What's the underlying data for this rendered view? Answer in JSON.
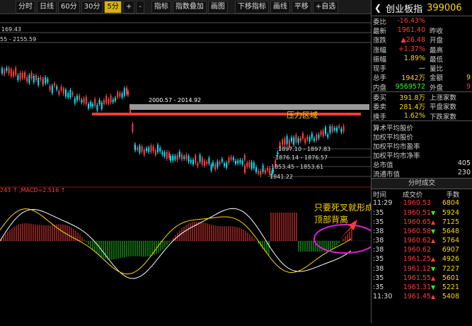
{
  "toolbar": {
    "buttons": [
      "分时",
      "日线",
      "60分",
      "30分",
      "5分",
      "+",
      "-",
      "指标",
      "指数叠加",
      "画图",
      "下移指标",
      "画线",
      "平移",
      "+自选"
    ],
    "active": "5分"
  },
  "chart": {
    "levels": [
      "169.43",
      "55 - 2155.59"
    ],
    "zone_label": "2000.57 - 2014.92",
    "pressure_label": "压力区域",
    "price_labels": [
      "1897.10 - 1897.83",
      "1876.14 - 1876.57",
      "1853.45 - 1853.61",
      "1841.22"
    ],
    "macd_label": "243 ↑ ,MACD=2.516 ↑",
    "annotation_line1": "只要死叉就形成",
    "annotation_line2": "顶部背离",
    "colors": {
      "pressure": "#ff3a3a",
      "zone": "#9a9a9a",
      "annotation": "#ffd800",
      "ellipse": "#e020e0",
      "up": "#ff4040",
      "down": "#00e8ff"
    }
  },
  "panel": {
    "back": "❮",
    "title": "创业板指",
    "code": "399006",
    "quote": [
      {
        "l1": "委比",
        "v1": "-16.43%",
        "c1": "red",
        "l2": "",
        "v2": "",
        "c2": "white"
      },
      {
        "l1": "最新",
        "v1": "1961.40",
        "c1": "red",
        "l2": "昨收",
        "v2": "",
        "c2": "white"
      },
      {
        "l1": "涨跌",
        "v1": "▲26.48",
        "c1": "red",
        "l2": "开盘",
        "v2": "",
        "c2": "white"
      },
      {
        "l1": "涨幅",
        "v1": "+1.37%",
        "c1": "red",
        "l2": "最高",
        "v2": "",
        "c2": "white"
      },
      {
        "l1": "振幅",
        "v1": "1.89%",
        "c1": "yellow",
        "l2": "最低",
        "v2": "",
        "c2": "white"
      },
      {
        "l1": "现手",
        "v1": "—",
        "c1": "white",
        "l2": "量比",
        "v2": "",
        "c2": "white"
      },
      {
        "l1": "总手",
        "v1": "1942万",
        "c1": "yellow",
        "l2": "金额",
        "v2": "9",
        "c2": "yellow"
      },
      {
        "l1": "内盘",
        "v1": "9569572",
        "c1": "green",
        "l2": "外盘",
        "v2": "9",
        "c2": "red"
      }
    ],
    "quote2": [
      {
        "l1": "委买",
        "v1": "391.8万",
        "c1": "yellow",
        "l2": "上涨家数",
        "v2": "",
        "c2": "white"
      },
      {
        "l1": "委卖",
        "v1": "281.4万",
        "c1": "yellow",
        "l2": "平盘家数",
        "v2": "",
        "c2": "white"
      },
      {
        "l1": "换手",
        "v1": "1.62%",
        "c1": "yellow",
        "l2": "下跌家数",
        "v2": "",
        "c2": "white"
      }
    ],
    "info": [
      {
        "label": "算术平均股价",
        "value": ""
      },
      {
        "label": "加权平均股价",
        "value": ""
      },
      {
        "label": "加权平均市盈率",
        "value": ""
      },
      {
        "label": "加权平均市净率",
        "value": ""
      },
      {
        "label": "总市值",
        "value": "405"
      },
      {
        "label": "流通市值",
        "value": "230"
      }
    ],
    "trades_title": "分时成交",
    "trades_cols": [
      "时间",
      "成交价",
      "手数"
    ],
    "trades": [
      {
        "t": "11:29",
        "p": "1960.53",
        "a": "",
        "q": "6804",
        "c": "red"
      },
      {
        "t": ":35",
        "p": "1960.51",
        "a": "▼",
        "q": "5924",
        "c": "red"
      },
      {
        "t": ":35",
        "p": "1960.65",
        "a": "▲",
        "q": "7125",
        "c": "red"
      },
      {
        "t": ":38",
        "p": "1960.58",
        "a": "▼",
        "q": "5648",
        "c": "red"
      },
      {
        "t": ":38",
        "p": "1960.62",
        "a": "▲",
        "q": "5764",
        "c": "red"
      },
      {
        "t": ":38",
        "p": "1960.62",
        "a": "",
        "q": "6907",
        "c": "red"
      },
      {
        "t": ":35",
        "p": "1961.25",
        "a": "▲",
        "q": "4926",
        "c": "red"
      },
      {
        "t": ":38",
        "p": "1961.12",
        "a": "▼",
        "q": "7227",
        "c": "red"
      },
      {
        "t": ":35",
        "p": "1961.55",
        "a": "▲",
        "q": "5601",
        "c": "red"
      },
      {
        "t": ":35",
        "p": "1961.31",
        "a": "▼",
        "q": "5221",
        "c": "red"
      },
      {
        "t": "11:30",
        "p": "1961.45",
        "a": "▲",
        "q": "5408",
        "c": "red"
      }
    ]
  }
}
